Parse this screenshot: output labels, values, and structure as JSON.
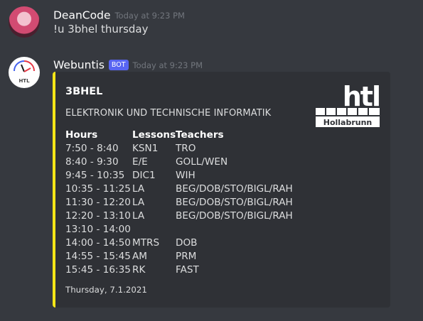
{
  "messages": [
    {
      "username": "DeanCode",
      "timestamp": "Today at 9:23 PM",
      "content": "!u 3bhel thursday"
    },
    {
      "username": "Webuntis",
      "bot_tag": "BOT",
      "timestamp": "Today at 9:23 PM",
      "embed": {
        "accent_color": "#f5e617",
        "title": "3BHEL",
        "description": "ELEKTRONIK UND TECHNISCHE INFORMATIK",
        "logo": {
          "top_text": "htl",
          "bottom_text": "Hollabrunn"
        },
        "fields": [
          {
            "name": "Hours",
            "values": [
              "7:50 - 8:40",
              "8:40 - 9:30",
              "9:45 - 10:35",
              "10:35 - 11:25",
              "11:30 - 12:20",
              "12:20 - 13:10",
              "13:10 - 14:00",
              "14:00 - 14:50",
              "14:55 - 15:45",
              "15:45 - 16:35"
            ]
          },
          {
            "name": "Lessons",
            "values": [
              "KSN1",
              "E/E",
              "DIC1",
              "LA",
              "LA",
              "LA",
              "",
              "MTRS",
              "AM",
              "RK"
            ]
          },
          {
            "name": "Teachers",
            "values": [
              "TRO",
              "GOLL/WEN",
              "WIH",
              "BEG/DOB/STO/BIGL/RAH",
              "BEG/DOB/STO/BIGL/RAH",
              "BEG/DOB/STO/BIGL/RAH",
              "",
              "DOB",
              "PRM",
              "FAST"
            ]
          }
        ],
        "footer": "Thursday, 7.1.2021"
      }
    }
  ],
  "bot_avatar_text": "HTL"
}
